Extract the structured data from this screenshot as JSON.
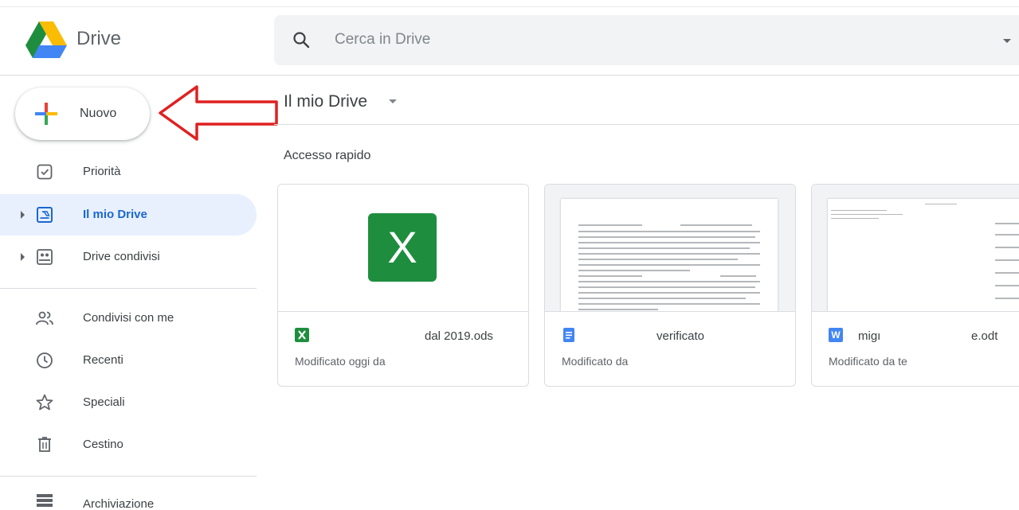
{
  "app": {
    "name": "Drive",
    "colors": {
      "accent": "#1a73e8",
      "active_bg": "#e8f0fe",
      "active_text": "#1967d2",
      "annotation_arrow": "#e02020"
    }
  },
  "search": {
    "placeholder": "Cerca in Drive",
    "icon": "search-icon"
  },
  "new_button": {
    "label": "Nuovo"
  },
  "sidebar": {
    "items": [
      {
        "label": "Priorità",
        "icon": "priority-check-icon"
      },
      {
        "label": "Il mio Drive",
        "icon": "my-drive-icon",
        "active": true
      },
      {
        "label": "Drive condivisi",
        "icon": "shared-drives-icon"
      },
      {
        "label": "Condivisi con me",
        "icon": "people-icon"
      },
      {
        "label": "Recenti",
        "icon": "clock-icon"
      },
      {
        "label": "Speciali",
        "icon": "star-icon"
      },
      {
        "label": "Cestino",
        "icon": "trash-icon"
      },
      {
        "label": "Archiviazione",
        "icon": "storage-icon"
      }
    ]
  },
  "main": {
    "breadcrumb": "Il mio Drive",
    "section_title": "Accesso rapido",
    "cards": [
      {
        "type": "sheet",
        "type_icon": "spreadsheet-icon",
        "name": "dal 2019.ods",
        "meta": "Modificato oggi da"
      },
      {
        "type": "doc",
        "type_icon": "docs-icon",
        "name": "verificato",
        "meta": "Modificato da"
      },
      {
        "type": "word",
        "type_icon": "word-icon",
        "name_start": "migı",
        "name_end": "e.odt",
        "meta": "Modificato da te"
      }
    ]
  }
}
